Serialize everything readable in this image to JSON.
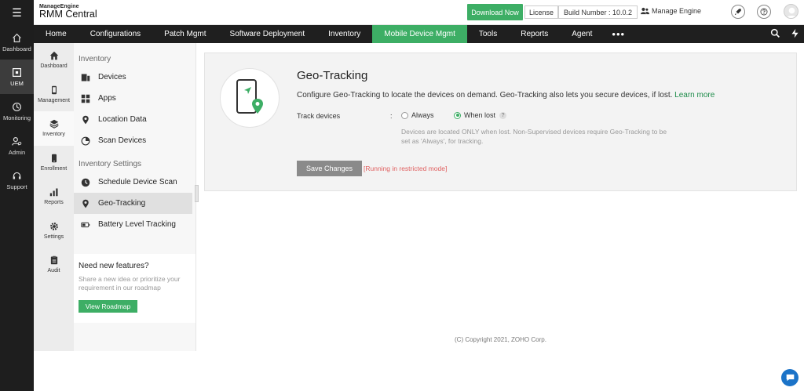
{
  "rail": {
    "items": [
      {
        "label": "Dashboard",
        "icon": "home-icon"
      },
      {
        "label": "UEM",
        "icon": "uem-icon",
        "active": true
      },
      {
        "label": "Monitoring",
        "icon": "monitor-icon"
      },
      {
        "label": "Admin",
        "icon": "admin-icon"
      },
      {
        "label": "Support",
        "icon": "support-icon"
      }
    ]
  },
  "header": {
    "brand_top": "ManageEngine",
    "brand_name": "RMM Central",
    "download_label": "Download Now",
    "license_label": "License",
    "build_label": "Build Number : 10.0.2",
    "account_label": "Manage Engine"
  },
  "nav": {
    "tabs": [
      {
        "label": "Home"
      },
      {
        "label": "Configurations"
      },
      {
        "label": "Patch Mgmt"
      },
      {
        "label": "Software Deployment"
      },
      {
        "label": "Inventory"
      },
      {
        "label": "Mobile Device Mgmt",
        "active": true
      },
      {
        "label": "Tools"
      },
      {
        "label": "Reports"
      },
      {
        "label": "Agent"
      }
    ],
    "more_label": "•••"
  },
  "modules": {
    "items": [
      {
        "label": "Dashboard"
      },
      {
        "label": "Management"
      },
      {
        "label": "Inventory",
        "active": true
      },
      {
        "label": "Enrollment"
      },
      {
        "label": "Reports"
      },
      {
        "label": "Settings"
      },
      {
        "label": "Audit"
      }
    ]
  },
  "submenu": {
    "group1": "Inventory",
    "items1": [
      {
        "label": "Devices"
      },
      {
        "label": "Apps"
      },
      {
        "label": "Location Data"
      },
      {
        "label": "Scan Devices"
      }
    ],
    "group2": "Inventory Settings",
    "items2": [
      {
        "label": "Schedule Device Scan"
      },
      {
        "label": "Geo-Tracking",
        "active": true
      },
      {
        "label": "Battery Level Tracking"
      }
    ],
    "feature_title": "Need new features?",
    "feature_desc": "Share a new idea or prioritize your requirement in our roadmap",
    "roadmap_label": "View Roadmap"
  },
  "content": {
    "title": "Geo-Tracking",
    "description": "Configure Geo-Tracking to locate the devices on demand. Geo-Tracking also lets you secure devices, if lost.",
    "learn_more": "Learn more",
    "track_label": "Track devices",
    "colon": ":",
    "option_always": "Always",
    "option_when_lost": "When lost",
    "help_mark": "?",
    "note": "Devices are located ONLY when lost. Non-Supervised devices require Geo-Tracking to be set as 'Always', for tracking.",
    "save_label": "Save Changes",
    "restricted_label": "[Running in restricted mode]"
  },
  "footer": {
    "copyright": "(C) Copyright 2021, ZOHO Corp."
  },
  "colors": {
    "accent": "#3dae65",
    "dark": "#1f1f1f",
    "link": "#1e8c4a",
    "warning": "#e06060"
  }
}
